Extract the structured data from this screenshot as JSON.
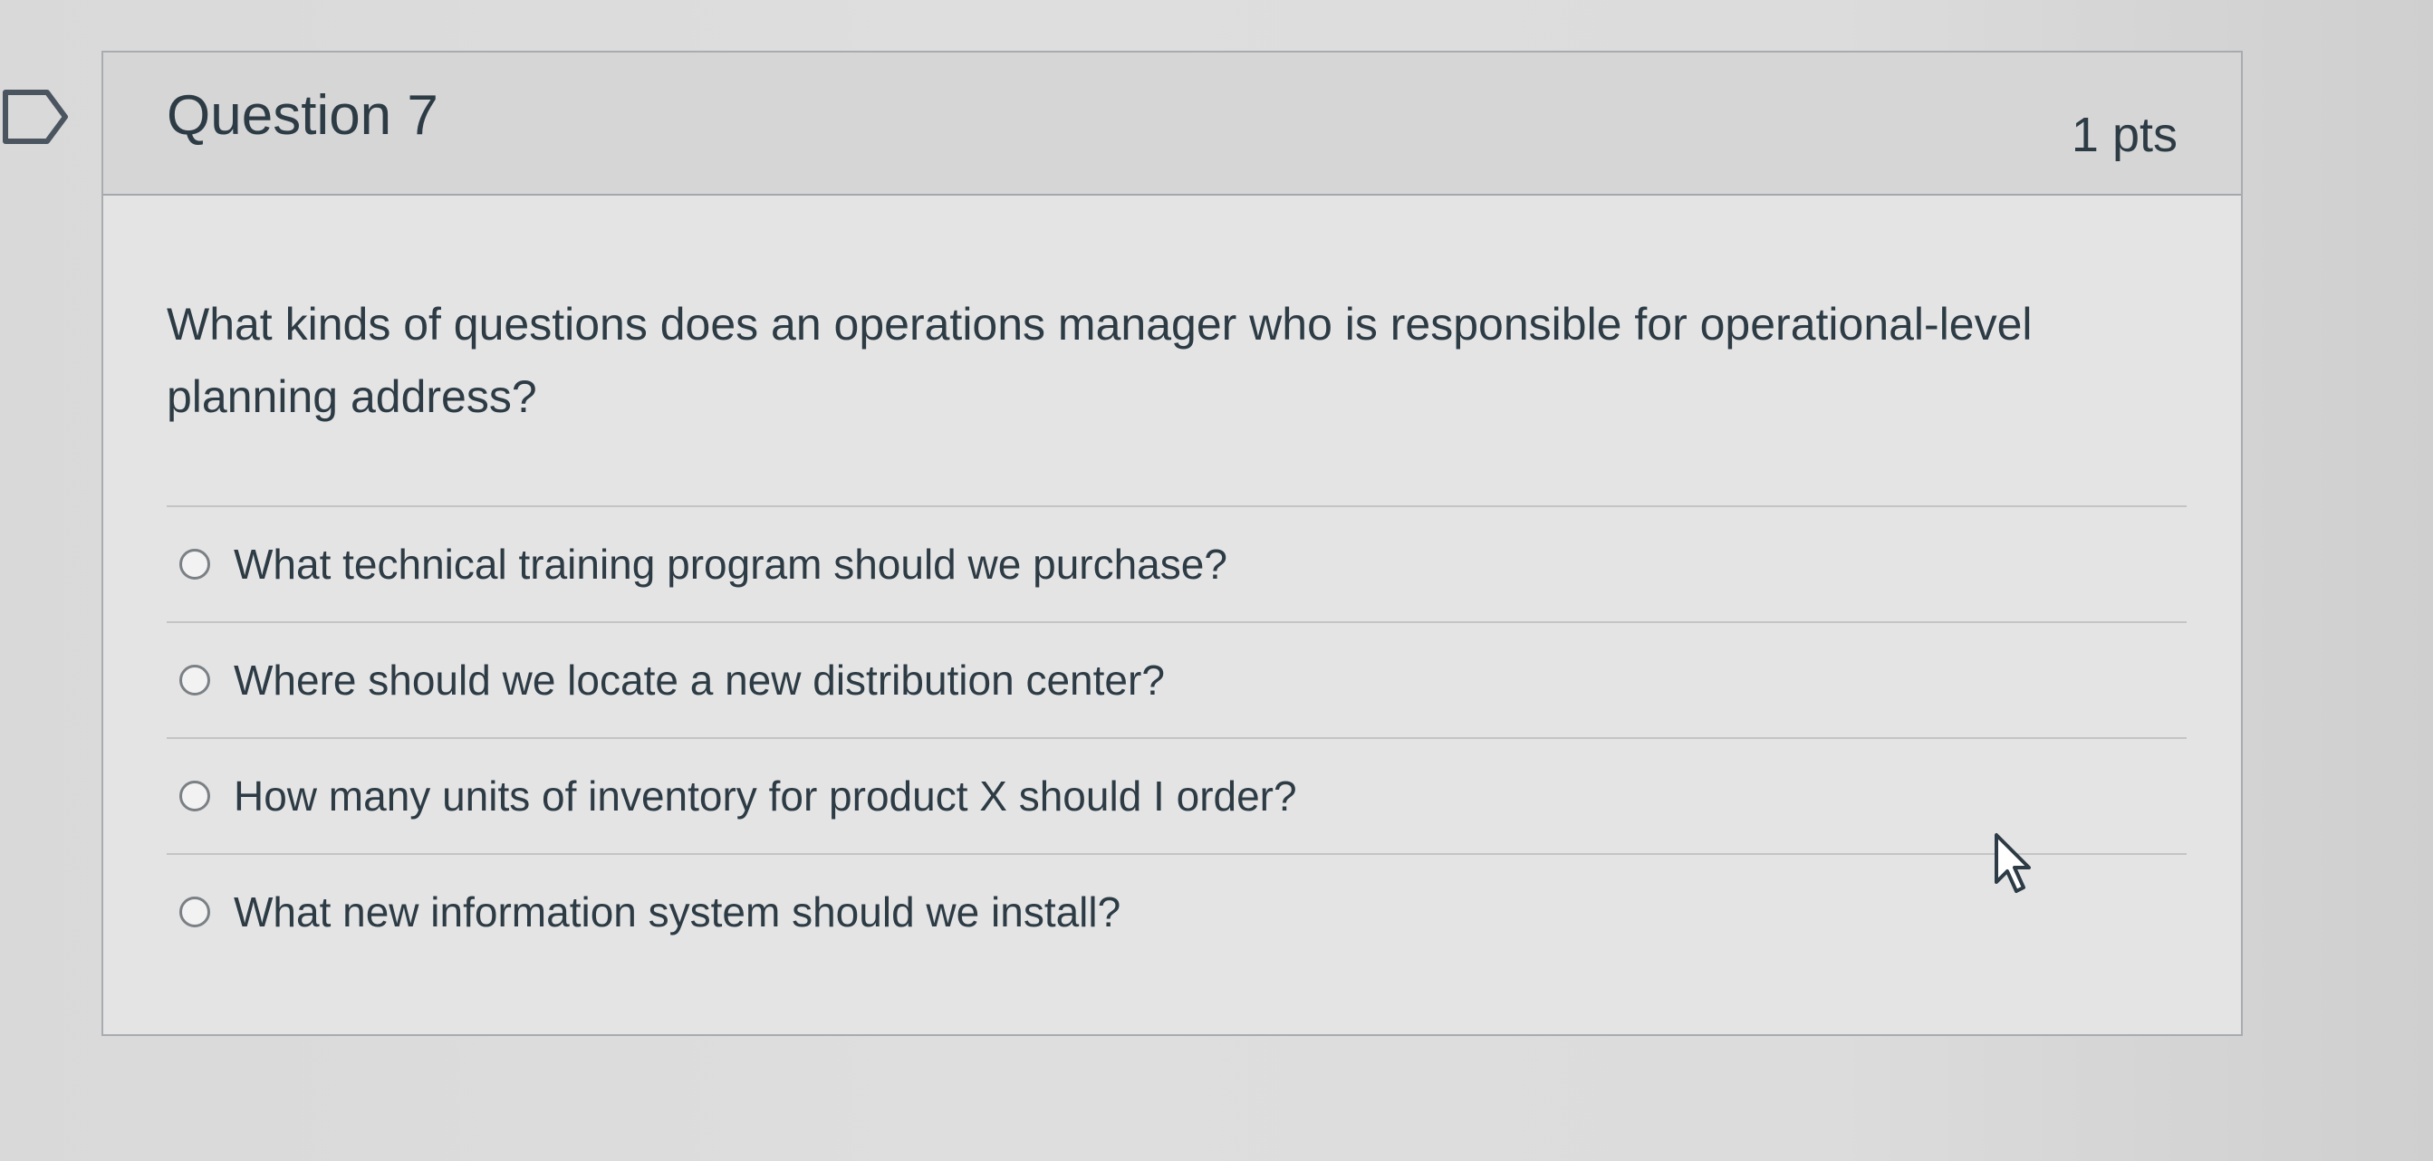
{
  "question": {
    "name": "Question 7",
    "points": "1 pts",
    "text": "What kinds of questions does an operations manager who is responsible for operational-level planning address?",
    "answers": [
      {
        "label": "What technical training program should we purchase?",
        "selected": false
      },
      {
        "label": "Where should we locate a new distribution center?",
        "selected": false
      },
      {
        "label": "How many units of inventory for product X should I order?",
        "selected": false
      },
      {
        "label": "What new information system should we install?",
        "selected": false
      }
    ]
  },
  "icons": {
    "flag": "flag-outline-icon",
    "cursor": "mouse-pointer-icon"
  },
  "colors": {
    "text": "#2d3b45",
    "header_background": "#d6d6d6",
    "card_background": "#e4e4e4",
    "border": "#a8acb0"
  }
}
